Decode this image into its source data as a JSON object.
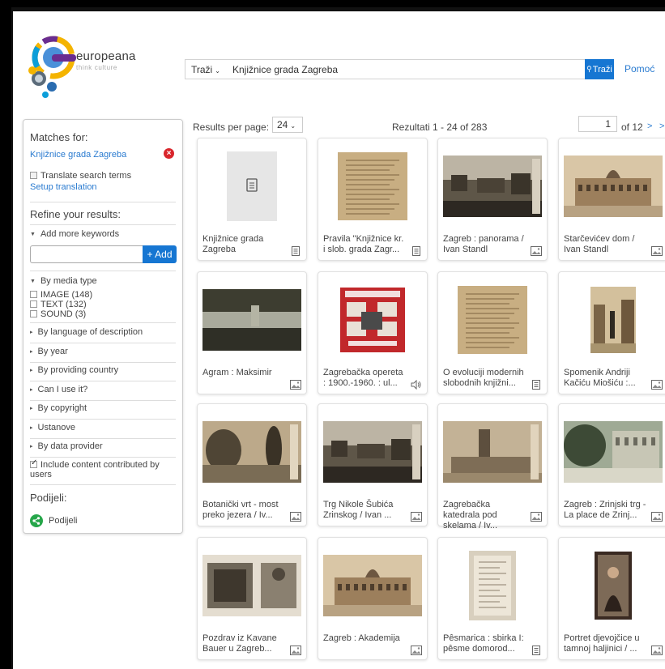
{
  "brand": {
    "name": "europeana",
    "tagline": "think culture"
  },
  "search": {
    "scope": "Traži",
    "query": "Knjižnice grada Zagreba",
    "button": "Traži",
    "help": "Pomoć"
  },
  "sidebar": {
    "matches_title": "Matches for:",
    "match_term": "Knjižnice grada Zagreba",
    "translate_label": "Translate search terms",
    "setup_translation": "Setup translation",
    "refine_title": "Refine your results:",
    "add_keywords": "Add more keywords",
    "add_button": "+ Add",
    "media_type": "By media type",
    "media_options": [
      "IMAGE (148)",
      "TEXT (132)",
      "SOUND (3)"
    ],
    "facets": [
      "By language of description",
      "By year",
      "By providing country",
      "Can I use it?",
      "By copyright",
      "Ustanove",
      "By data provider"
    ],
    "include_label": "Include content contributed by users",
    "share_title": "Podijeli:",
    "share_label": "Podijeli"
  },
  "results": {
    "per_page_label": "Results per page:",
    "per_page_value": "24",
    "count": "Rezultati  1 - 24 of 283",
    "page": "1",
    "of_pages": "of 12",
    "next": ">",
    "last": ">"
  },
  "cards": [
    {
      "title": "Knjižnice grada Zagreba",
      "type": "text-icon",
      "thumb": "placeholder"
    },
    {
      "title": "Pravila \"Knjižnice kr. i slob. grada Zagr...",
      "type": "text-icon",
      "thumb": "document"
    },
    {
      "title": "Zagreb : panorama / Ivan Standl",
      "type": "image-icon",
      "thumb": "photo-city"
    },
    {
      "title": "Starčevićev dom / Ivan Standl",
      "type": "image-icon",
      "thumb": "photo-building"
    },
    {
      "title": "Agram : Maksimir",
      "type": "image-icon",
      "thumb": "photo-lake"
    },
    {
      "title": "Zagrebačka opereta : 1900.-1960. : ul...",
      "type": "sound-icon",
      "thumb": "poster-red"
    },
    {
      "title": "O evoluciji modernih slobodnih knjižni...",
      "type": "text-icon",
      "thumb": "document"
    },
    {
      "title": "Spomenik Andriji Kačiću Miošiću :...",
      "type": "image-icon",
      "thumb": "photo-street"
    },
    {
      "title": "Botanički vrt - most preko jezera / Iv...",
      "type": "image-icon",
      "thumb": "photo-trees"
    },
    {
      "title": "Trg Nikole Šubića Zrinskog / Ivan ...",
      "type": "image-icon",
      "thumb": "photo-city"
    },
    {
      "title": "Zagrebačka katedrala pod skelama / Iv...",
      "type": "image-icon",
      "thumb": "photo-cathedral"
    },
    {
      "title": "Zagreb : Zrinjski trg - La place de Zrinj...",
      "type": "image-icon",
      "thumb": "photo-square"
    },
    {
      "title": "Pozdrav iz Kavane Bauer u Zagreb...",
      "type": "image-icon",
      "thumb": "photo-postcard"
    },
    {
      "title": "Zagreb : Akademija",
      "type": "image-icon",
      "thumb": "photo-building"
    },
    {
      "title": "Pêsmarica : sbirka I: pêsme domorod...",
      "type": "text-icon",
      "thumb": "booklet"
    },
    {
      "title": "Portret djevojčice u tamnoj haljinici / ...",
      "type": "image-icon",
      "thumb": "portrait"
    }
  ],
  "colors": {
    "accent": "#1676d2",
    "link": "#2a7bd0",
    "remove": "#d9262c",
    "share": "#26a64a"
  }
}
